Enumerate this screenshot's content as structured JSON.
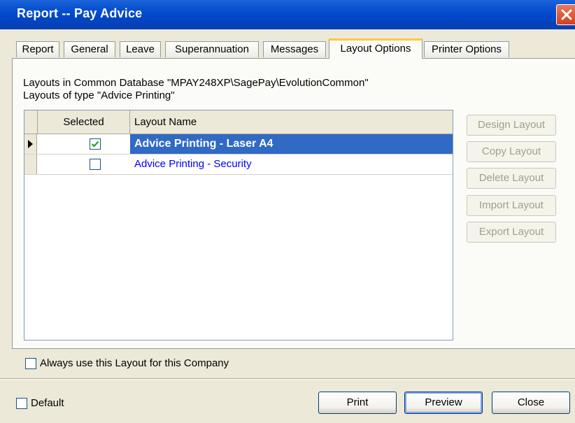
{
  "window": {
    "title": "Report -- Pay Advice"
  },
  "tabs": [
    {
      "label": "Report"
    },
    {
      "label": "General"
    },
    {
      "label": "Leave"
    },
    {
      "label": "Superannuation"
    },
    {
      "label": "Messages"
    },
    {
      "label": "Layout Options",
      "active": true
    },
    {
      "label": "Printer Options"
    }
  ],
  "info": {
    "line1": "Layouts in Common Database \"MPAY248XP\\SagePay\\EvolutionCommon\"",
    "line2": "Layouts of type \"Advice Printing\""
  },
  "grid": {
    "columns": [
      "Selected",
      "Layout Name"
    ],
    "rows": [
      {
        "selected": true,
        "name": "Advice Printing - Laser A4",
        "current": true
      },
      {
        "selected": false,
        "name": "Advice Printing - Security",
        "current": false
      }
    ]
  },
  "side_buttons": {
    "design": "Design Layout",
    "copy": "Copy Layout",
    "delete": "Delete Layout",
    "import": "Import Layout",
    "export": "Export Layout"
  },
  "always_use": {
    "label": "Always use this Layout for this Company",
    "checked": false
  },
  "footer": {
    "default_label": "Default",
    "print": "Print",
    "preview": "Preview",
    "close": "Close"
  },
  "colors": {
    "titlebar": "#0a54d0",
    "selection": "#316ac5",
    "link_text": "#0000ff"
  }
}
